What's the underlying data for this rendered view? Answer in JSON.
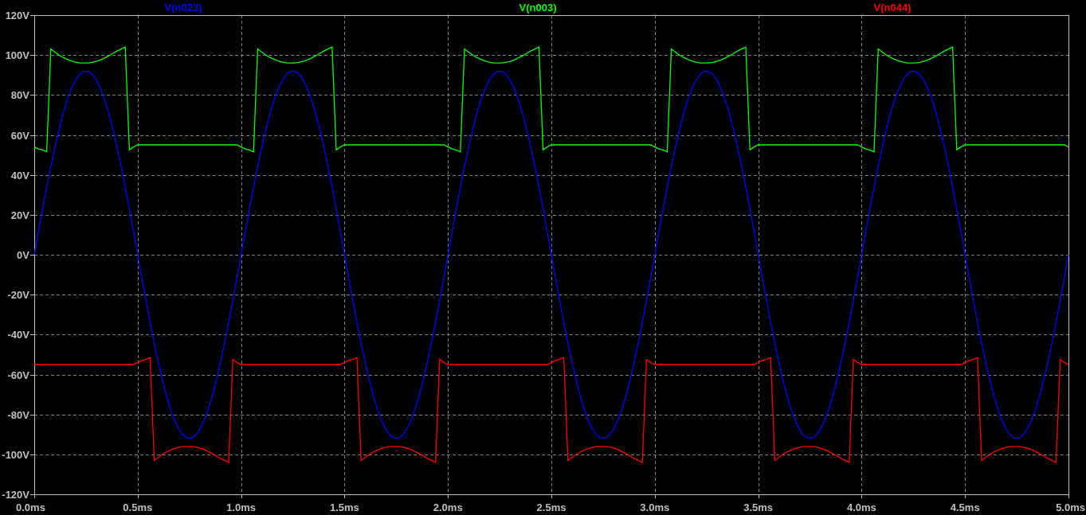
{
  "plot": {
    "chart_data": {
      "type": "line",
      "grid": true,
      "xlim": [
        0,
        5
      ],
      "ylim": [
        -120,
        120
      ],
      "xticks": [
        {
          "value": 0,
          "label": "0.0ms"
        },
        {
          "value": 0.5,
          "label": "0.5ms"
        },
        {
          "value": 1,
          "label": "1.0ms"
        },
        {
          "value": 1.5,
          "label": "1.5ms"
        },
        {
          "value": 2,
          "label": "2.0ms"
        },
        {
          "value": 2.5,
          "label": "2.5ms"
        },
        {
          "value": 3,
          "label": "3.0ms"
        },
        {
          "value": 3.5,
          "label": "3.5ms"
        },
        {
          "value": 4,
          "label": "4.0ms"
        },
        {
          "value": 4.5,
          "label": "4.5ms"
        },
        {
          "value": 5,
          "label": "5.0ms"
        }
      ],
      "yticks": [
        {
          "value": 120,
          "label": "120V"
        },
        {
          "value": 100,
          "label": "100V"
        },
        {
          "value": 80,
          "label": "80V"
        },
        {
          "value": 60,
          "label": "60V"
        },
        {
          "value": 40,
          "label": "40V"
        },
        {
          "value": 20,
          "label": "20V"
        },
        {
          "value": 0,
          "label": "0V"
        },
        {
          "value": -20,
          "label": "-20V"
        },
        {
          "value": -40,
          "label": "-40V"
        },
        {
          "value": -60,
          "label": "-60V"
        },
        {
          "value": -80,
          "label": "-80V"
        },
        {
          "value": -100,
          "label": "-100V"
        },
        {
          "value": -120,
          "label": "-120V"
        }
      ],
      "x": [
        0,
        0.02,
        0.04,
        0.06,
        0.08,
        0.1,
        0.12,
        0.14,
        0.16,
        0.18,
        0.2,
        0.22,
        0.24,
        0.26,
        0.28,
        0.3,
        0.32,
        0.34,
        0.36,
        0.38,
        0.4,
        0.42,
        0.44,
        0.46,
        0.48,
        0.5,
        0.52,
        0.54,
        0.56,
        0.58,
        0.6,
        0.62,
        0.64,
        0.66,
        0.68,
        0.7,
        0.72,
        0.74,
        0.76,
        0.78,
        0.8,
        0.82,
        0.84,
        0.86,
        0.88,
        0.9,
        0.92,
        0.94,
        0.96,
        0.98,
        1,
        1.02,
        1.04,
        1.06,
        1.08,
        1.1,
        1.12,
        1.14,
        1.16,
        1.18,
        1.2,
        1.22,
        1.24,
        1.26,
        1.28,
        1.3,
        1.32,
        1.34,
        1.36,
        1.38,
        1.4,
        1.42,
        1.44,
        1.46,
        1.48,
        1.5,
        1.52,
        1.54,
        1.56,
        1.58,
        1.6,
        1.62,
        1.64,
        1.66,
        1.68,
        1.7,
        1.72,
        1.74,
        1.76,
        1.78,
        1.8,
        1.82,
        1.84,
        1.86,
        1.88,
        1.9,
        1.92,
        1.94,
        1.96,
        1.98,
        2,
        2.02,
        2.04,
        2.06,
        2.08,
        2.1,
        2.12,
        2.14,
        2.16,
        2.18,
        2.2,
        2.22,
        2.24,
        2.26,
        2.28,
        2.3,
        2.32,
        2.34,
        2.36,
        2.38,
        2.4,
        2.42,
        2.44,
        2.46,
        2.48,
        2.5,
        2.52,
        2.54,
        2.56,
        2.58,
        2.6,
        2.62,
        2.64,
        2.66,
        2.68,
        2.7,
        2.72,
        2.74,
        2.76,
        2.78,
        2.8,
        2.82,
        2.84,
        2.86,
        2.88,
        2.9,
        2.92,
        2.94,
        2.96,
        2.98,
        3,
        3.02,
        3.04,
        3.06,
        3.08,
        3.1,
        3.12,
        3.14,
        3.16,
        3.18,
        3.2,
        3.22,
        3.24,
        3.26,
        3.28,
        3.3,
        3.32,
        3.34,
        3.36,
        3.38,
        3.4,
        3.42,
        3.44,
        3.46,
        3.48,
        3.5,
        3.52,
        3.54,
        3.56,
        3.58,
        3.6,
        3.62,
        3.64,
        3.66,
        3.68,
        3.7,
        3.72,
        3.74,
        3.76,
        3.78,
        3.8,
        3.82,
        3.84,
        3.86,
        3.88,
        3.9,
        3.92,
        3.94,
        3.96,
        3.98,
        4,
        4.02,
        4.04,
        4.06,
        4.08,
        4.1,
        4.12,
        4.14,
        4.16,
        4.18,
        4.2,
        4.22,
        4.24,
        4.26,
        4.28,
        4.3,
        4.32,
        4.34,
        4.36,
        4.38,
        4.4,
        4.42,
        4.44,
        4.46,
        4.48,
        4.5,
        4.52,
        4.54,
        4.56,
        4.58,
        4.6,
        4.62,
        4.64,
        4.66,
        4.68,
        4.7,
        4.72,
        4.74,
        4.76,
        4.78,
        4.8,
        4.82,
        4.84,
        4.86,
        4.88,
        4.9,
        4.92,
        4.94,
        4.96,
        4.98,
        5
      ],
      "series": [
        {
          "name": "V(n023)",
          "color": "#0000ff",
          "values": [
            0,
            11.5,
            22.9,
            33.9,
            44.3,
            54.1,
            63,
            70.9,
            77.7,
            83.2,
            87.5,
            90.4,
            91.8,
            91.8,
            90.4,
            87.5,
            83.2,
            77.7,
            70.9,
            63,
            54.1,
            44.3,
            33.9,
            22.9,
            11.5,
            0,
            -11.5,
            -22.9,
            -33.9,
            -44.3,
            -54.1,
            -63,
            -70.9,
            -77.7,
            -83.2,
            -87.5,
            -90.4,
            -91.8,
            -91.8,
            -90.4,
            -87.5,
            -83.2,
            -77.7,
            -70.9,
            -63,
            -54.1,
            -44.3,
            -33.9,
            -22.9,
            -11.5,
            0,
            11.5,
            22.9,
            33.9,
            44.3,
            54.1,
            63,
            70.9,
            77.7,
            83.2,
            87.5,
            90.4,
            91.8,
            91.8,
            90.4,
            87.5,
            83.2,
            77.7,
            70.9,
            63,
            54.1,
            44.3,
            33.9,
            22.9,
            11.5,
            0,
            -11.5,
            -22.9,
            -33.9,
            -44.3,
            -54.1,
            -63,
            -70.9,
            -77.7,
            -83.2,
            -87.5,
            -90.4,
            -91.8,
            -91.8,
            -90.4,
            -87.5,
            -83.2,
            -77.7,
            -70.9,
            -63,
            -54.1,
            -44.3,
            -33.9,
            -22.9,
            -11.5,
            0,
            11.5,
            22.9,
            33.9,
            44.3,
            54.1,
            63,
            70.9,
            77.7,
            83.2,
            87.5,
            90.4,
            91.8,
            91.8,
            90.4,
            87.5,
            83.2,
            77.7,
            70.9,
            63,
            54.1,
            44.3,
            33.9,
            22.9,
            11.5,
            0,
            -11.5,
            -22.9,
            -33.9,
            -44.3,
            -54.1,
            -63,
            -70.9,
            -77.7,
            -83.2,
            -87.5,
            -90.4,
            -91.8,
            -91.8,
            -90.4,
            -87.5,
            -83.2,
            -77.7,
            -70.9,
            -63,
            -54.1,
            -44.3,
            -33.9,
            -22.9,
            -11.5,
            0,
            11.5,
            22.9,
            33.9,
            44.3,
            54.1,
            63,
            70.9,
            77.7,
            83.2,
            87.5,
            90.4,
            91.8,
            91.8,
            90.4,
            87.5,
            83.2,
            77.7,
            70.9,
            63,
            54.1,
            44.3,
            33.9,
            22.9,
            11.5,
            0,
            -11.5,
            -22.9,
            -33.9,
            -44.3,
            -54.1,
            -63,
            -70.9,
            -77.7,
            -83.2,
            -87.5,
            -90.4,
            -91.8,
            -91.8,
            -90.4,
            -87.5,
            -83.2,
            -77.7,
            -70.9,
            -63,
            -54.1,
            -44.3,
            -33.9,
            -22.9,
            -11.5,
            0,
            11.5,
            22.9,
            33.9,
            44.3,
            54.1,
            63,
            70.9,
            77.7,
            83.2,
            87.5,
            90.4,
            91.8,
            91.8,
            90.4,
            87.5,
            83.2,
            77.7,
            70.9,
            63,
            54.1,
            44.3,
            33.9,
            22.9,
            11.5,
            0,
            -11.5,
            -22.9,
            -33.9,
            -44.3,
            -54.1,
            -63,
            -70.9,
            -77.7,
            -83.2,
            -87.5,
            -90.4,
            -91.8,
            -91.8,
            -90.4,
            -87.5,
            -83.2,
            -77.7,
            -70.9,
            -63,
            -54.1,
            -44.3,
            -33.9,
            -22.9,
            -11.5,
            0
          ]
        },
        {
          "name": "V(n003)",
          "color": "#00ff00",
          "values": [
            54,
            53,
            52.5,
            51.5,
            103,
            101.5,
            100,
            98.8,
            97.8,
            97,
            96.4,
            96,
            96,
            96,
            96.3,
            96.8,
            97.5,
            98.5,
            99.6,
            100.8,
            102,
            103,
            104,
            52.5,
            54,
            55,
            55,
            55,
            55,
            55,
            55,
            55,
            55,
            55,
            55,
            55,
            55,
            55,
            55,
            55,
            55,
            55,
            55,
            55,
            55,
            55,
            55,
            55,
            55,
            55,
            54,
            53,
            52.5,
            51.5,
            103,
            101.5,
            100,
            98.8,
            97.8,
            97,
            96.4,
            96,
            96,
            96,
            96.3,
            96.8,
            97.5,
            98.5,
            99.6,
            100.8,
            102,
            103,
            104,
            52.5,
            54,
            55,
            55,
            55,
            55,
            55,
            55,
            55,
            55,
            55,
            55,
            55,
            55,
            55,
            55,
            55,
            55,
            55,
            55,
            55,
            55,
            55,
            55,
            55,
            55,
            55,
            54,
            53,
            52.5,
            51.5,
            103,
            101.5,
            100,
            98.8,
            97.8,
            97,
            96.4,
            96,
            96,
            96,
            96.3,
            96.8,
            97.5,
            98.5,
            99.6,
            100.8,
            102,
            103,
            104,
            52.5,
            54,
            55,
            55,
            55,
            55,
            55,
            55,
            55,
            55,
            55,
            55,
            55,
            55,
            55,
            55,
            55,
            55,
            55,
            55,
            55,
            55,
            55,
            55,
            55,
            55,
            55,
            54,
            53,
            52.5,
            51.5,
            103,
            101.5,
            100,
            98.8,
            97.8,
            97,
            96.4,
            96,
            96,
            96,
            96.3,
            96.8,
            97.5,
            98.5,
            99.6,
            100.8,
            102,
            103,
            104,
            52.5,
            54,
            55,
            55,
            55,
            55,
            55,
            55,
            55,
            55,
            55,
            55,
            55,
            55,
            55,
            55,
            55,
            55,
            55,
            55,
            55,
            55,
            55,
            55,
            55,
            55,
            55,
            54,
            53,
            52.5,
            51.5,
            103,
            101.5,
            100,
            98.8,
            97.8,
            97,
            96.4,
            96,
            96,
            96,
            96.3,
            96.8,
            97.5,
            98.5,
            99.6,
            100.8,
            102,
            103,
            104,
            52.5,
            54,
            55,
            55,
            55,
            55,
            55,
            55,
            55,
            55,
            55,
            55,
            55,
            55,
            55,
            55,
            55,
            55,
            55,
            55,
            55,
            55,
            55,
            55,
            55,
            55,
            55,
            54
          ]
        },
        {
          "name": "V(n044)",
          "color": "#ff0000",
          "values": [
            -55,
            -55,
            -55,
            -55,
            -55,
            -55,
            -55,
            -55,
            -55,
            -55,
            -55,
            -55,
            -55,
            -55,
            -55,
            -55,
            -55,
            -55,
            -55,
            -55,
            -55,
            -55,
            -55,
            -55,
            -55,
            -54,
            -53,
            -52.5,
            -51.5,
            -103,
            -101.5,
            -100,
            -98.8,
            -97.8,
            -97,
            -96.4,
            -96,
            -96,
            -96,
            -96.3,
            -96.8,
            -97.5,
            -98.5,
            -99.6,
            -100.8,
            -102,
            -103,
            -104,
            -52.5,
            -54,
            -55,
            -55,
            -55,
            -55,
            -55,
            -55,
            -55,
            -55,
            -55,
            -55,
            -55,
            -55,
            -55,
            -55,
            -55,
            -55,
            -55,
            -55,
            -55,
            -55,
            -55,
            -55,
            -55,
            -55,
            -55,
            -54,
            -53,
            -52.5,
            -51.5,
            -103,
            -101.5,
            -100,
            -98.8,
            -97.8,
            -97,
            -96.4,
            -96,
            -96,
            -96,
            -96.3,
            -96.8,
            -97.5,
            -98.5,
            -99.6,
            -100.8,
            -102,
            -103,
            -104,
            -52.5,
            -54,
            -55,
            -55,
            -55,
            -55,
            -55,
            -55,
            -55,
            -55,
            -55,
            -55,
            -55,
            -55,
            -55,
            -55,
            -55,
            -55,
            -55,
            -55,
            -55,
            -55,
            -55,
            -55,
            -55,
            -55,
            -55,
            -54,
            -53,
            -52.5,
            -51.5,
            -103,
            -101.5,
            -100,
            -98.8,
            -97.8,
            -97,
            -96.4,
            -96,
            -96,
            -96,
            -96.3,
            -96.8,
            -97.5,
            -98.5,
            -99.6,
            -100.8,
            -102,
            -103,
            -104,
            -52.5,
            -54,
            -55,
            -55,
            -55,
            -55,
            -55,
            -55,
            -55,
            -55,
            -55,
            -55,
            -55,
            -55,
            -55,
            -55,
            -55,
            -55,
            -55,
            -55,
            -55,
            -55,
            -55,
            -55,
            -55,
            -55,
            -55,
            -54,
            -53,
            -52.5,
            -51.5,
            -103,
            -101.5,
            -100,
            -98.8,
            -97.8,
            -97,
            -96.4,
            -96,
            -96,
            -96,
            -96.3,
            -96.8,
            -97.5,
            -98.5,
            -99.6,
            -100.8,
            -102,
            -103,
            -104,
            -52.5,
            -54,
            -55,
            -55,
            -55,
            -55,
            -55,
            -55,
            -55,
            -55,
            -55,
            -55,
            -55,
            -55,
            -55,
            -55,
            -55,
            -55,
            -55,
            -55,
            -55,
            -55,
            -55,
            -55,
            -55,
            -55,
            -55,
            -54,
            -53,
            -52.5,
            -51.5,
            -103,
            -101.5,
            -100,
            -98.8,
            -97.8,
            -97,
            -96.4,
            -96,
            -96,
            -96,
            -96.3,
            -96.8,
            -97.5,
            -98.5,
            -99.6,
            -100.8,
            -102,
            -103,
            -104,
            -52.5,
            -54,
            -55
          ]
        }
      ]
    }
  }
}
